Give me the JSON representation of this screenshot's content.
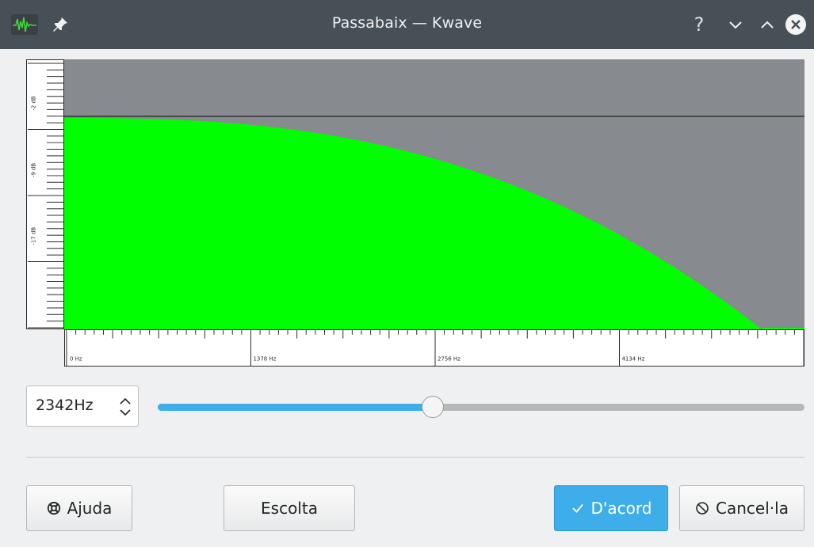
{
  "window": {
    "title": "Passabaix — Kwave",
    "help_glyph": "?",
    "app_icon": "kwave-waveform-icon",
    "pin_icon": "pin-icon",
    "controls": [
      "help-icon",
      "minimize-icon",
      "maximize-icon",
      "close-icon"
    ]
  },
  "graph": {
    "y_labels": [
      "-2 dB",
      "-9 dB",
      "-17 dB"
    ],
    "x_labels": [
      "0 Hz",
      "1378 Hz",
      "2756 Hz",
      "4134 Hz"
    ],
    "curve_color": "#00ff00",
    "background_color": "#878a8e"
  },
  "frequency": {
    "value": "2342Hz",
    "slider_fraction": 0.425
  },
  "buttons": {
    "help": "Ajuda",
    "listen": "Escolta",
    "ok": "D'acord",
    "cancel": "Cancel·la"
  },
  "colors": {
    "accent": "#3daee9",
    "titlebar": "#475057"
  }
}
